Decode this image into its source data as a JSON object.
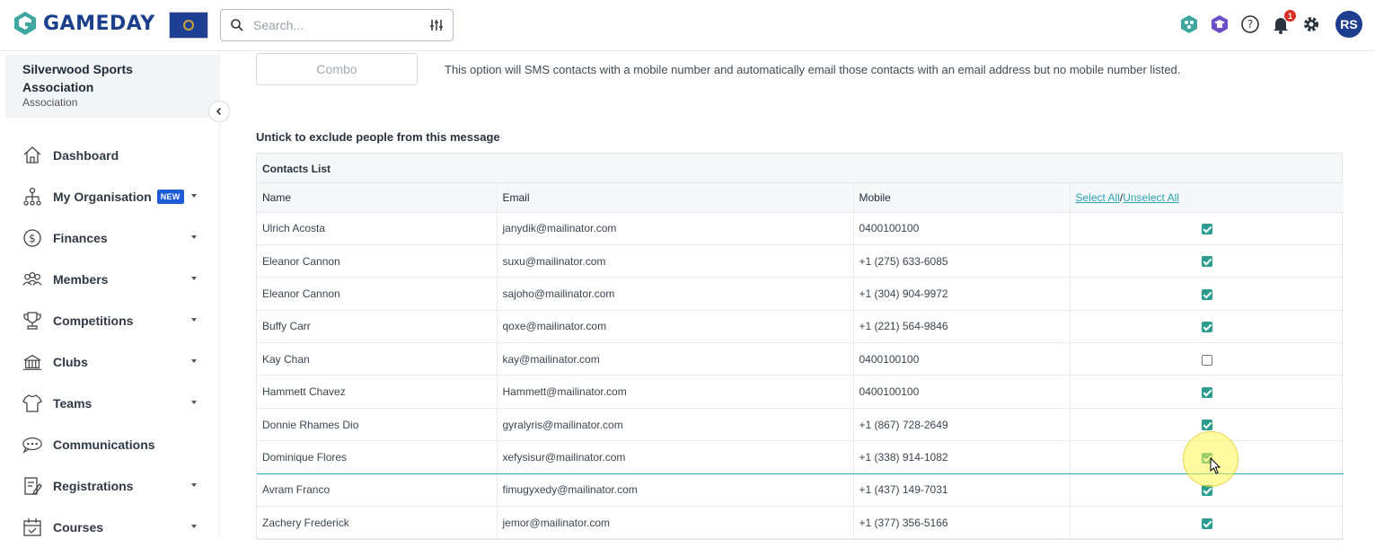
{
  "header": {
    "logo_text": "GAMEDAY",
    "search_placeholder": "Search...",
    "notification_count": "1",
    "avatar_initials": "RS"
  },
  "sidebar": {
    "org_name": "Silverwood Sports Association",
    "org_type": "Association",
    "items": [
      {
        "label": "Dashboard",
        "icon": "home-icon",
        "caret": false,
        "new": ""
      },
      {
        "label": "My Organisation",
        "icon": "org-chart-icon",
        "caret": true,
        "new": "NEW"
      },
      {
        "label": "Finances",
        "icon": "dollar-icon",
        "caret": true,
        "new": ""
      },
      {
        "label": "Members",
        "icon": "members-icon",
        "caret": true,
        "new": ""
      },
      {
        "label": "Competitions",
        "icon": "trophy-icon",
        "caret": true,
        "new": ""
      },
      {
        "label": "Clubs",
        "icon": "club-icon",
        "caret": true,
        "new": ""
      },
      {
        "label": "Teams",
        "icon": "jersey-icon",
        "caret": true,
        "new": ""
      },
      {
        "label": "Communications",
        "icon": "chat-icon",
        "caret": false,
        "new": ""
      },
      {
        "label": "Registrations",
        "icon": "registration-icon",
        "caret": true,
        "new": ""
      },
      {
        "label": "Courses",
        "icon": "calendar-icon",
        "caret": true,
        "new": ""
      }
    ]
  },
  "main": {
    "combo_label": "Combo",
    "combo_description": "This option will SMS contacts with a mobile number and automatically email those contacts with an email address but no mobile number listed.",
    "untick_label": "Untick to exclude people from this message",
    "table": {
      "caption": "Contacts List",
      "headers": {
        "name": "Name",
        "email": "Email",
        "mobile": "Mobile"
      },
      "select_all": "Select All",
      "separator": "/",
      "unselect_all": "Unselect All",
      "rows": [
        {
          "name": "Ulrich Acosta",
          "email": "janydik@mailinator.com",
          "mobile": "0400100100",
          "checked": true
        },
        {
          "name": "Eleanor Cannon",
          "email": "suxu@mailinator.com",
          "mobile": "+1 (275) 633-6085",
          "checked": true
        },
        {
          "name": "Eleanor Cannon",
          "email": "sajoho@mailinator.com",
          "mobile": "+1 (304) 904-9972",
          "checked": true
        },
        {
          "name": "Buffy Carr",
          "email": "qoxe@mailinator.com",
          "mobile": "+1 (221) 564-9846",
          "checked": true
        },
        {
          "name": "Kay Chan",
          "email": "kay@mailinator.com",
          "mobile": "0400100100",
          "checked": false
        },
        {
          "name": "Hammett Chavez",
          "email": "Hammett@mailinator.com",
          "mobile": "0400100100",
          "checked": true
        },
        {
          "name": "Donnie Rhames Dio",
          "email": "gyralyris@mailinator.com",
          "mobile": "+1 (867) 728-2649",
          "checked": true
        },
        {
          "name": "Dominique Flores",
          "email": "xefysisur@mailinator.com",
          "mobile": "+1 (338) 914-1082",
          "checked": true
        },
        {
          "name": "Avram Franco",
          "email": "fimugyxedy@mailinator.com",
          "mobile": "+1 (437) 149-7031",
          "checked": true
        },
        {
          "name": "Zachery Frederick",
          "email": "jemor@mailinator.com",
          "mobile": "+1 (377) 356-5166",
          "checked": true
        }
      ]
    }
  },
  "colors": {
    "brand": "#1b3f8c",
    "accent": "#2a9d8f",
    "link": "#2ba3b6"
  }
}
